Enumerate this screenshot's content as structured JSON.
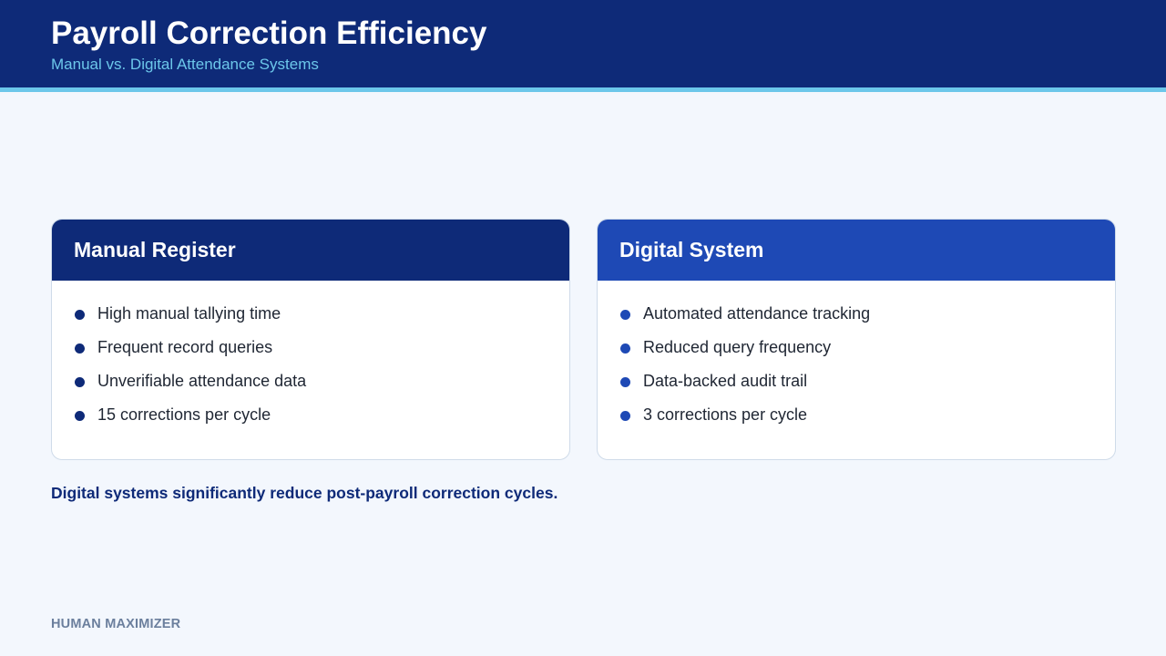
{
  "header": {
    "title": "Payroll Correction Efficiency",
    "subtitle": "Manual vs. Digital Attendance Systems"
  },
  "cards": [
    {
      "title": "Manual Register",
      "accent": "#0e2a78",
      "items": [
        "High manual tallying time",
        "Frequent record queries",
        "Unverifiable attendance data",
        "15 corrections per cycle"
      ]
    },
    {
      "title": "Digital System",
      "accent": "#1e49b5",
      "items": [
        "Automated attendance tracking",
        "Reduced query frequency",
        "Data-backed audit trail",
        "3 corrections per cycle"
      ]
    }
  ],
  "conclusion": "Digital systems significantly reduce post-payroll correction cycles.",
  "footer": {
    "brand": "HUMAN MAXIMIZER"
  },
  "colors": {
    "header_bg": "#0e2a78",
    "header_accent": "#6cc7ea",
    "page_bg": "#f3f7fd"
  }
}
